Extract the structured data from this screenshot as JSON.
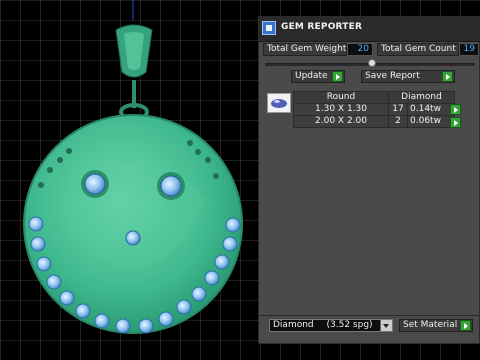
{
  "panel": {
    "title": "GEM REPORTER",
    "total_weight_label": "Total Gem Weight",
    "total_weight_value": "20",
    "total_count_label": "Total Gem Count",
    "total_count_value": "19",
    "update_label": "Update",
    "save_report_label": "Save Report",
    "table": {
      "headers": [
        "Round",
        "Diamond"
      ],
      "rows": [
        {
          "size": "1.30 X 1.30",
          "count": "17",
          "weight": "0.14tw"
        },
        {
          "size": "2.00 X 2.00",
          "count": "2",
          "weight": "0.06tw"
        }
      ]
    },
    "material_select": "Diamond",
    "material_spg": "(3.52 spg)",
    "set_material_label": "Set Material"
  },
  "colors": {
    "model": "#3fb88d",
    "accent": "#3aa23a",
    "value_text": "#4fb0ff"
  }
}
